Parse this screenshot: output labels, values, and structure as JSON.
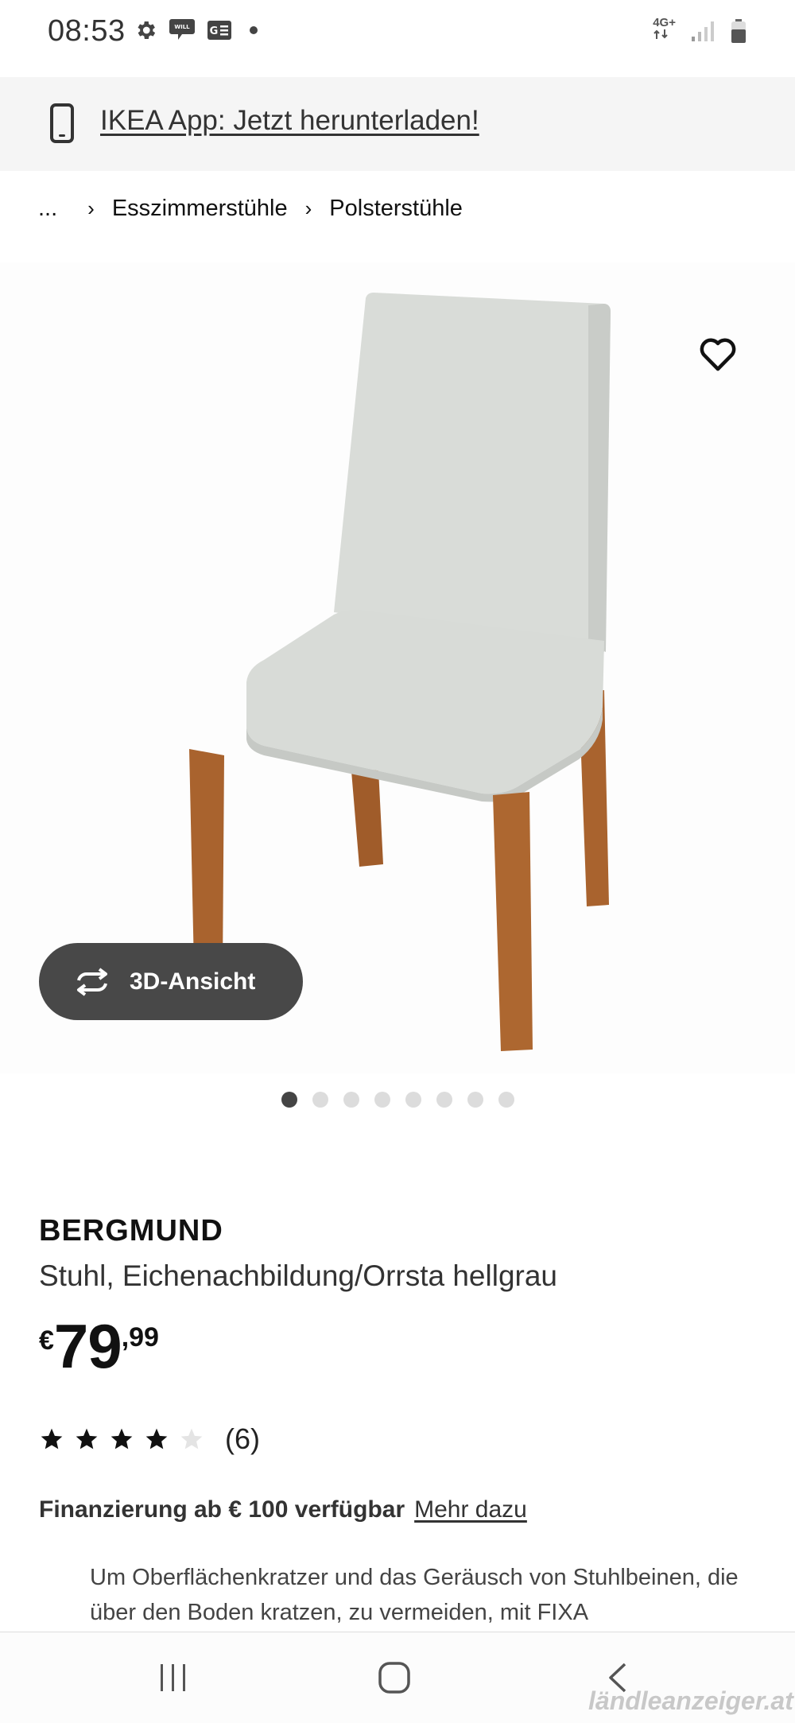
{
  "status_bar": {
    "time": "08:53",
    "network_label": "4G+",
    "icons": [
      "gear-icon",
      "chat-icon",
      "news-icon",
      "dot-icon",
      "network-icon",
      "signal-icon",
      "battery-icon"
    ]
  },
  "app_banner": {
    "icon": "phone-icon",
    "link_text": "IKEA App: Jetzt herunterladen!"
  },
  "breadcrumb": {
    "ellipsis": "...",
    "separator": "›",
    "items": [
      "Esszimmerstühle",
      "Polsterstühle"
    ]
  },
  "gallery": {
    "view_3d_label": "3D-Ansicht",
    "image_count": 8,
    "active_index": 0
  },
  "product": {
    "name": "BERGMUND",
    "description": "Stuhl, Eichenachbildung/Orrsta hellgrau",
    "price": {
      "currency": "€",
      "integer": "79",
      "decimal": ",99"
    },
    "rating": {
      "stars": 4,
      "max_stars": 5,
      "count": "(6)"
    },
    "financing": {
      "text": "Finanzierung ab € 100 verfügbar",
      "link": "Mehr dazu"
    },
    "info_text": "Um Oberflächenkratzer und das Geräusch von Stuhlbeinen, die über den Boden kratzen, zu vermeiden, mit FIXA"
  },
  "nav_bar": {
    "icons": [
      "recent-apps-icon",
      "home-icon",
      "back-icon"
    ]
  },
  "watermark": "ländleanzeiger.at",
  "colors": {
    "banner_bg": "#f5f5f5",
    "button_3d_bg": "#484848",
    "chair_fabric": "#d9dcd8",
    "chair_wood": "#a9632e",
    "dot_active": "#444444",
    "dot_inactive": "#dcdcdc"
  }
}
